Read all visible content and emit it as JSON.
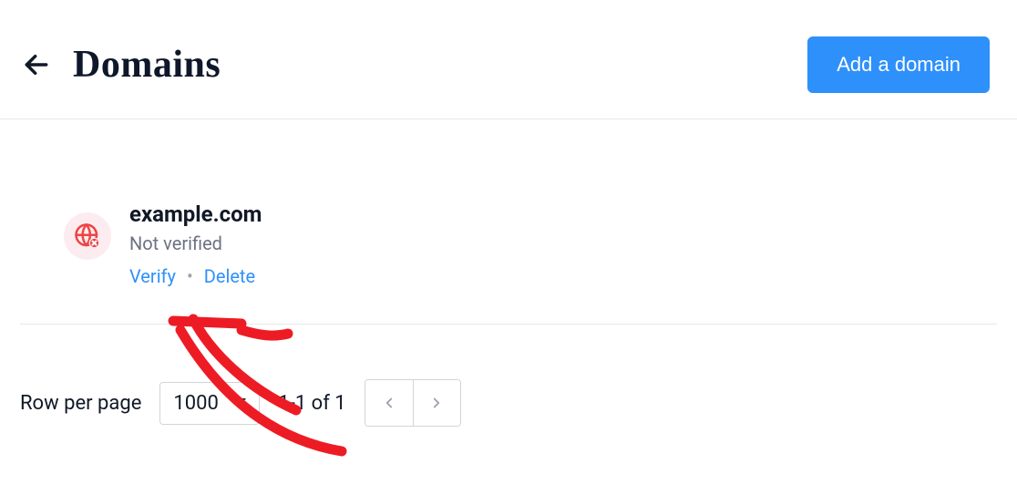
{
  "header": {
    "title": "Domains",
    "add_button": "Add a domain"
  },
  "domain": {
    "name": "example.com",
    "status": "Not verified",
    "actions": {
      "verify": "Verify",
      "separator": "•",
      "delete": "Delete"
    }
  },
  "pagination": {
    "rows_label": "Row per page",
    "rows_value": "1000",
    "range": "1-1 of 1"
  },
  "colors": {
    "primary": "#2e90fa",
    "danger": "#ef4444",
    "danger_bg": "#fdecef",
    "text": "#111827",
    "muted": "#6b7280",
    "border": "#e5e7eb"
  }
}
